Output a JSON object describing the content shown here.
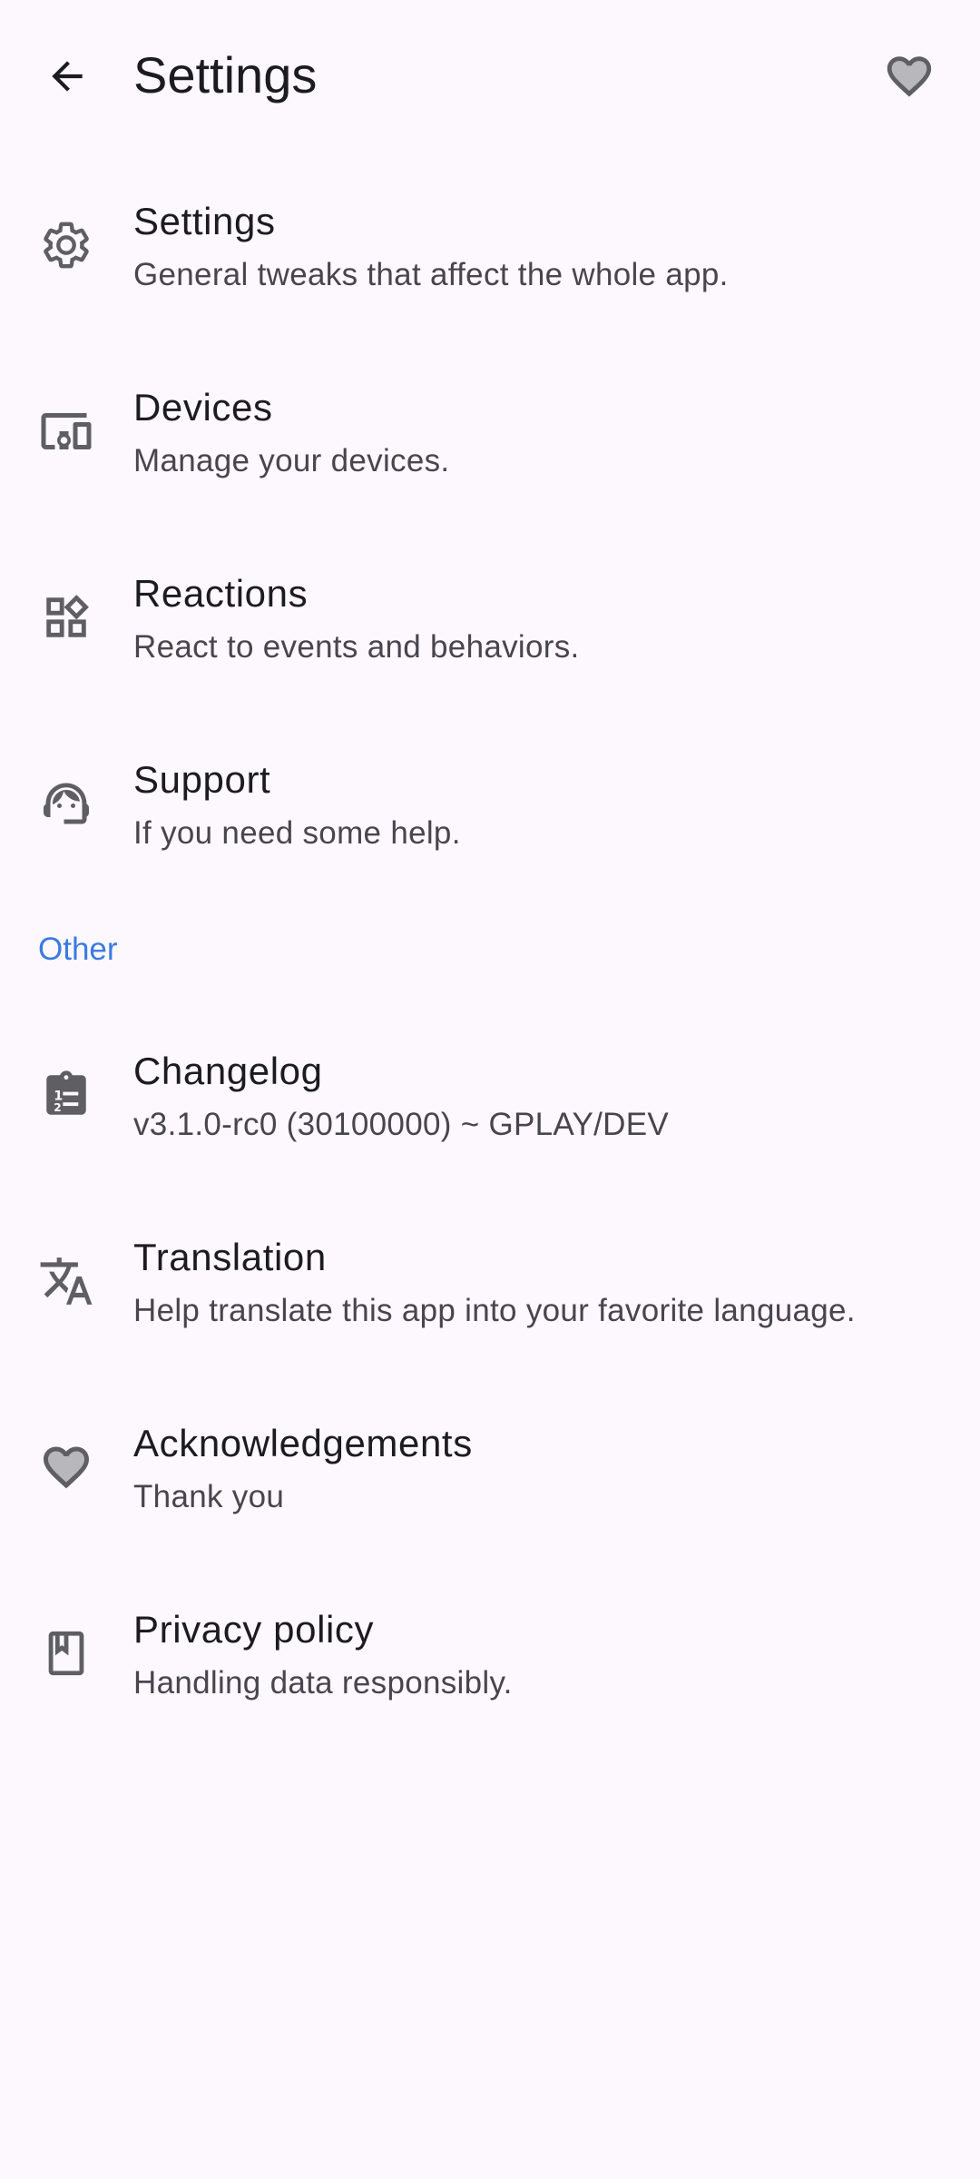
{
  "header": {
    "title": "Settings",
    "back_icon": "arrow-back-icon",
    "favorite_icon": "heart-icon"
  },
  "items": [
    {
      "title": "Settings",
      "subtitle": "General tweaks that affect the whole app.",
      "icon": "gear-icon"
    },
    {
      "title": "Devices",
      "subtitle": "Manage your devices.",
      "icon": "devices-icon"
    },
    {
      "title": "Reactions",
      "subtitle": "React to events and behaviors.",
      "icon": "widgets-icon"
    },
    {
      "title": "Support",
      "subtitle": "If you need some help.",
      "icon": "support-agent-icon"
    }
  ],
  "section_other": {
    "label": "Other",
    "items": [
      {
        "title": "Changelog",
        "subtitle": "v3.1.0-rc0 (30100000) ~ GPLAY/DEV",
        "icon": "changelog-icon"
      },
      {
        "title": "Translation",
        "subtitle": "Help translate this app into your favorite language.",
        "icon": "translate-icon"
      },
      {
        "title": "Acknowledgements",
        "subtitle": "Thank you",
        "icon": "heart-icon"
      },
      {
        "title": "Privacy policy",
        "subtitle": "Handling data responsibly.",
        "icon": "book-icon"
      }
    ]
  },
  "colors": {
    "background": "#fcf8fd",
    "accent": "#3c7be0",
    "icon": "#5f5f63",
    "text_primary": "#1c1b1f",
    "text_secondary": "#49454f"
  }
}
